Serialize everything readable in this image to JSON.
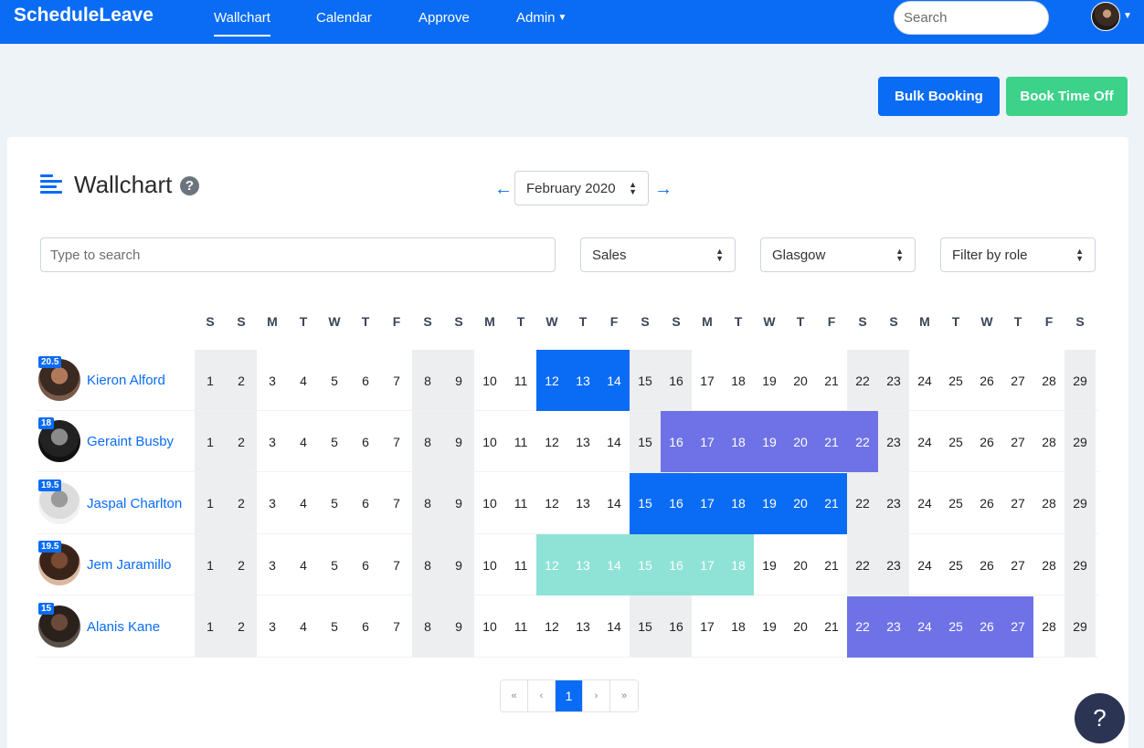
{
  "nav": {
    "brand": "ScheduleLeave",
    "links": [
      "Wallchart",
      "Calendar",
      "Approve",
      "Admin"
    ],
    "search_placeholder": "Search"
  },
  "actions": {
    "bulk_booking": "Bulk Booking",
    "book_time_off": "Book Time Off"
  },
  "wallchart": {
    "title": "Wallchart",
    "help": "?",
    "month": "February 2020",
    "search_placeholder": "Type to search",
    "filters": {
      "department": "Sales",
      "location": "Glasgow",
      "role": "Filter by role"
    }
  },
  "calendar": {
    "day_letters": [
      "S",
      "S",
      "M",
      "T",
      "W",
      "T",
      "F",
      "S",
      "S",
      "M",
      "T",
      "W",
      "T",
      "F",
      "S",
      "S",
      "M",
      "T",
      "W",
      "T",
      "F",
      "S",
      "S",
      "M",
      "T",
      "W",
      "T",
      "F",
      "S"
    ],
    "days": [
      1,
      2,
      3,
      4,
      5,
      6,
      7,
      8,
      9,
      10,
      11,
      12,
      13,
      14,
      15,
      16,
      17,
      18,
      19,
      20,
      21,
      22,
      23,
      24,
      25,
      26,
      27,
      28,
      29
    ],
    "weekend_days": [
      1,
      2,
      8,
      9,
      15,
      16,
      22,
      23,
      29
    ]
  },
  "employees": [
    {
      "name": "Kieron Alford",
      "allowance": "20.5",
      "leave": [
        {
          "from": 12,
          "to": 14,
          "color": "#0a6cf5"
        }
      ]
    },
    {
      "name": "Geraint Busby",
      "allowance": "18",
      "leave": [
        {
          "from": 16,
          "to": 22,
          "color": "#6f72e6"
        }
      ]
    },
    {
      "name": "Jaspal Charlton",
      "allowance": "19.5",
      "leave": [
        {
          "from": 15,
          "to": 21,
          "color": "#0a6cf5"
        }
      ]
    },
    {
      "name": "Jem Jaramillo",
      "allowance": "19.5",
      "leave": [
        {
          "from": 12,
          "to": 18,
          "color": "#8ee3d6"
        }
      ]
    },
    {
      "name": "Alanis Kane",
      "allowance": "15",
      "leave": [
        {
          "from": 22,
          "to": 27,
          "color": "#6f72e6"
        }
      ]
    }
  ],
  "pagination": {
    "first": "«",
    "prev": "‹",
    "current": "1",
    "next": "›",
    "last": "»"
  },
  "help_fab": "?"
}
